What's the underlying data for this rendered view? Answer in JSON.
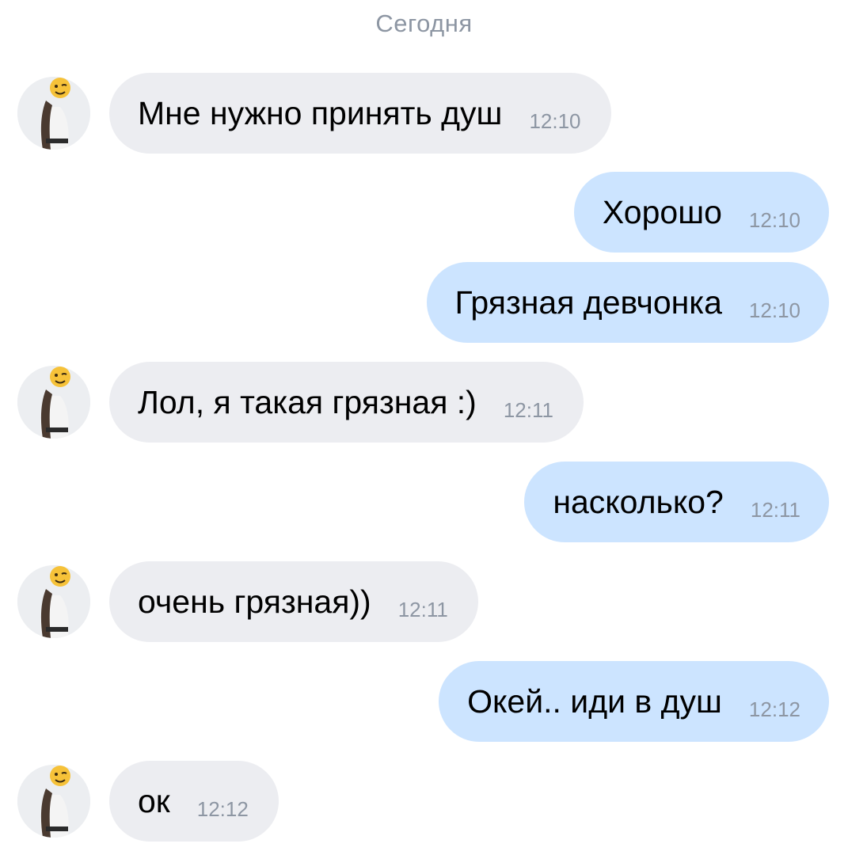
{
  "colors": {
    "incoming_bubble": "#ecedf1",
    "outgoing_bubble": "#cce4ff",
    "meta_text": "#8d96a3"
  },
  "chat": {
    "date_header": "Сегодня",
    "messages": [
      {
        "direction": "in",
        "text": "Мне нужно принять душ",
        "time": "12:10",
        "avatar": "contact-avatar"
      },
      {
        "direction": "out",
        "text": "Хорошо",
        "time": "12:10"
      },
      {
        "direction": "out",
        "text": "Грязная девчонка",
        "time": "12:10"
      },
      {
        "direction": "in",
        "text": "Лол, я такая грязная :)",
        "time": "12:11",
        "avatar": "contact-avatar"
      },
      {
        "direction": "out",
        "text": "насколько?",
        "time": "12:11"
      },
      {
        "direction": "in",
        "text": "очень грязная))",
        "time": "12:11",
        "avatar": "contact-avatar"
      },
      {
        "direction": "out",
        "text": "Окей.. иди в душ",
        "time": "12:12"
      },
      {
        "direction": "in",
        "text": "ок",
        "time": "12:12",
        "avatar": "contact-avatar"
      }
    ]
  }
}
